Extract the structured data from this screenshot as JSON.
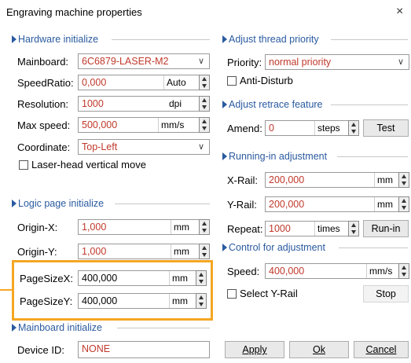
{
  "window": {
    "title": "Engraving machine properties",
    "close": "×"
  },
  "hardware": {
    "title": "Hardware initialize",
    "mainboard_label": "Mainboard:",
    "mainboard_value": "6C6879-LASER-M2",
    "speedratio_label": "SpeedRatio:",
    "speedratio_value": "0,000",
    "speedratio_unit": "Auto",
    "resolution_label": "Resolution:",
    "resolution_value": "1000",
    "resolution_unit": "dpi",
    "maxspeed_label": "Max speed:",
    "maxspeed_value": "500,000",
    "maxspeed_unit": "mm/s",
    "coordinate_label": "Coordinate:",
    "coordinate_value": "Top-Left",
    "laserhead_label": "Laser-head vertical move"
  },
  "logic": {
    "title": "Logic page initialize",
    "originx_label": "Origin-X:",
    "originx_value": "1,000",
    "originx_unit": "mm",
    "originy_label": "Origin-Y:",
    "originy_value": "1,000",
    "originy_unit": "mm",
    "pagesizex_label": "PageSizeX:",
    "pagesizex_value": "400,000",
    "pagesizex_unit": "mm",
    "pagesizey_label": "PageSizeY:",
    "pagesizey_value": "400,000",
    "pagesizey_unit": "mm"
  },
  "mainboard_init": {
    "title": "Mainboard initialize",
    "deviceid_label": "Device ID:",
    "deviceid_value": "NONE"
  },
  "thread": {
    "title": "Adjust thread priority",
    "priority_label": "Priority:",
    "priority_value": "normal priority",
    "antidisturb_label": "Anti-Disturb"
  },
  "retrace": {
    "title": "Adjust retrace feature",
    "amend_label": "Amend:",
    "amend_value": "0",
    "amend_unit": "steps",
    "test_button": "Test"
  },
  "runin": {
    "title": "Running-in adjustment",
    "xrail_label": "X-Rail:",
    "xrail_value": "200,000",
    "xrail_unit": "mm",
    "yrail_label": "Y-Rail:",
    "yrail_value": "200,000",
    "yrail_unit": "mm",
    "repeat_label": "Repeat:",
    "repeat_value": "1000",
    "repeat_unit": "times",
    "runin_button": "Run-in"
  },
  "control": {
    "title": "Control for adjustment",
    "speed_label": "Speed:",
    "speed_value": "400,000",
    "speed_unit": "mm/s",
    "selectyrail_label": "Select Y-Rail",
    "stop_button": "Stop"
  },
  "footer": {
    "apply": "Apply",
    "ok": "Ok",
    "cancel": "Cancel"
  },
  "colors": {
    "section": "#2a5aa0",
    "value": "#c0392b",
    "highlight": "#f5a623"
  }
}
